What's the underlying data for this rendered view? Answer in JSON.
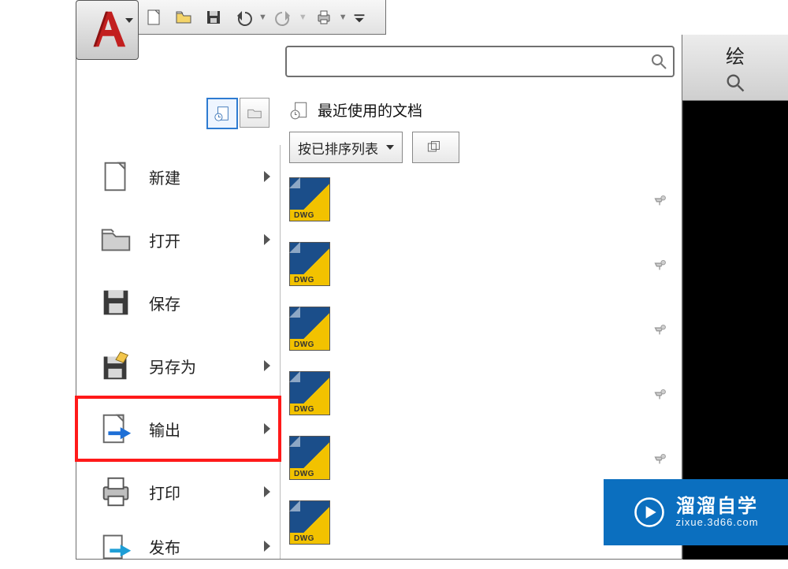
{
  "qat": {
    "icons": [
      "new",
      "open",
      "save",
      "undo",
      "redo",
      "print",
      "dropdown"
    ]
  },
  "app_letter": "A",
  "search": {
    "value": "",
    "placeholder": ""
  },
  "recent": {
    "title": "最近使用的文档",
    "sort_label": "按已排序列表",
    "dwg_tag": "DWG"
  },
  "menu": {
    "items": [
      {
        "key": "new",
        "label": "新建",
        "arrow": true
      },
      {
        "key": "open",
        "label": "打开",
        "arrow": true
      },
      {
        "key": "save",
        "label": "保存",
        "arrow": false
      },
      {
        "key": "saveas",
        "label": "另存为",
        "arrow": true
      },
      {
        "key": "export",
        "label": "输出",
        "arrow": true,
        "highlight": true
      },
      {
        "key": "print",
        "label": "打印",
        "arrow": true
      },
      {
        "key": "publish",
        "label": "发布",
        "arrow": true
      }
    ]
  },
  "right_tab_label": "绘",
  "watermark": {
    "line1": "溜溜自学",
    "line2": "zixue.3d66.com"
  }
}
